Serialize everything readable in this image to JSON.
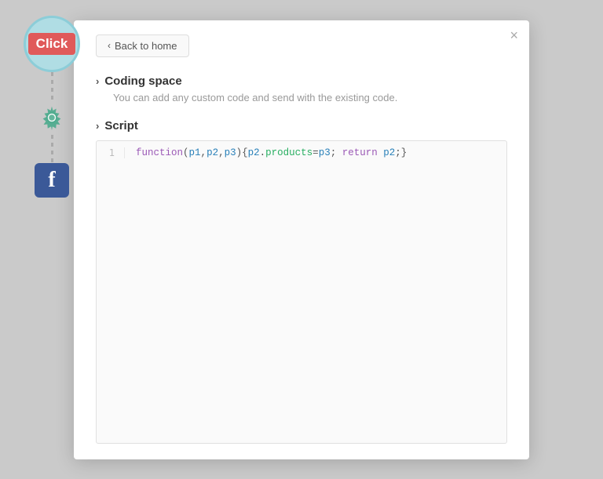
{
  "close": "×",
  "back_button": "Back to home",
  "coding_space": {
    "chevron": "›",
    "title": "Coding space",
    "description": "You can add any custom code and send with the existing code."
  },
  "script": {
    "chevron": "›",
    "title": "Script"
  },
  "code": {
    "line_number": "1",
    "content": "function(p1,p2,p3){p2.products=p3; return p2;}"
  },
  "flow": {
    "click_label": "Click"
  }
}
